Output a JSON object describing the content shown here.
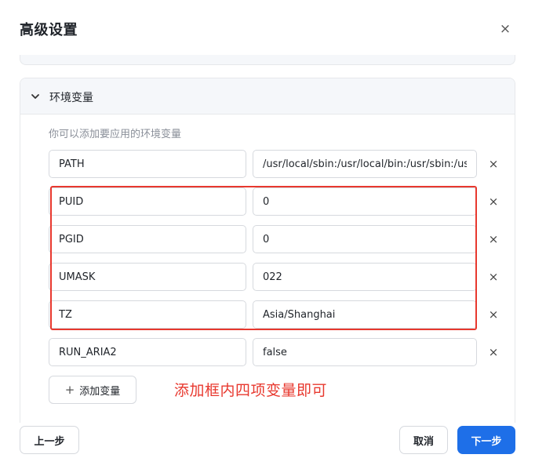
{
  "dialog": {
    "title": "高级设置",
    "close_glyph": "×"
  },
  "section": {
    "title": "环境变量",
    "expanded": true,
    "hint": "你可以添加要应用的环境变量"
  },
  "env_vars": [
    {
      "key": "PATH",
      "value": "/usr/local/sbin:/usr/local/bin:/usr/sbin:/usr/bin:/sbin:/bin"
    },
    {
      "key": "PUID",
      "value": "0"
    },
    {
      "key": "PGID",
      "value": "0"
    },
    {
      "key": "UMASK",
      "value": "022"
    },
    {
      "key": "TZ",
      "value": "Asia/Shanghai"
    },
    {
      "key": "RUN_ARIA2",
      "value": "false"
    }
  ],
  "remove_glyph": "×",
  "add_button": {
    "label": "添加变量",
    "icon": "plus-icon",
    "glyph": "+"
  },
  "annotation": {
    "text": "添加框内四项变量即可",
    "color": "#e8382e"
  },
  "footer": {
    "prev_label": "上一步",
    "cancel_label": "取消",
    "next_label": "下一步"
  },
  "colors": {
    "primary": "#1e6fe8",
    "highlight": "#e8382e"
  }
}
